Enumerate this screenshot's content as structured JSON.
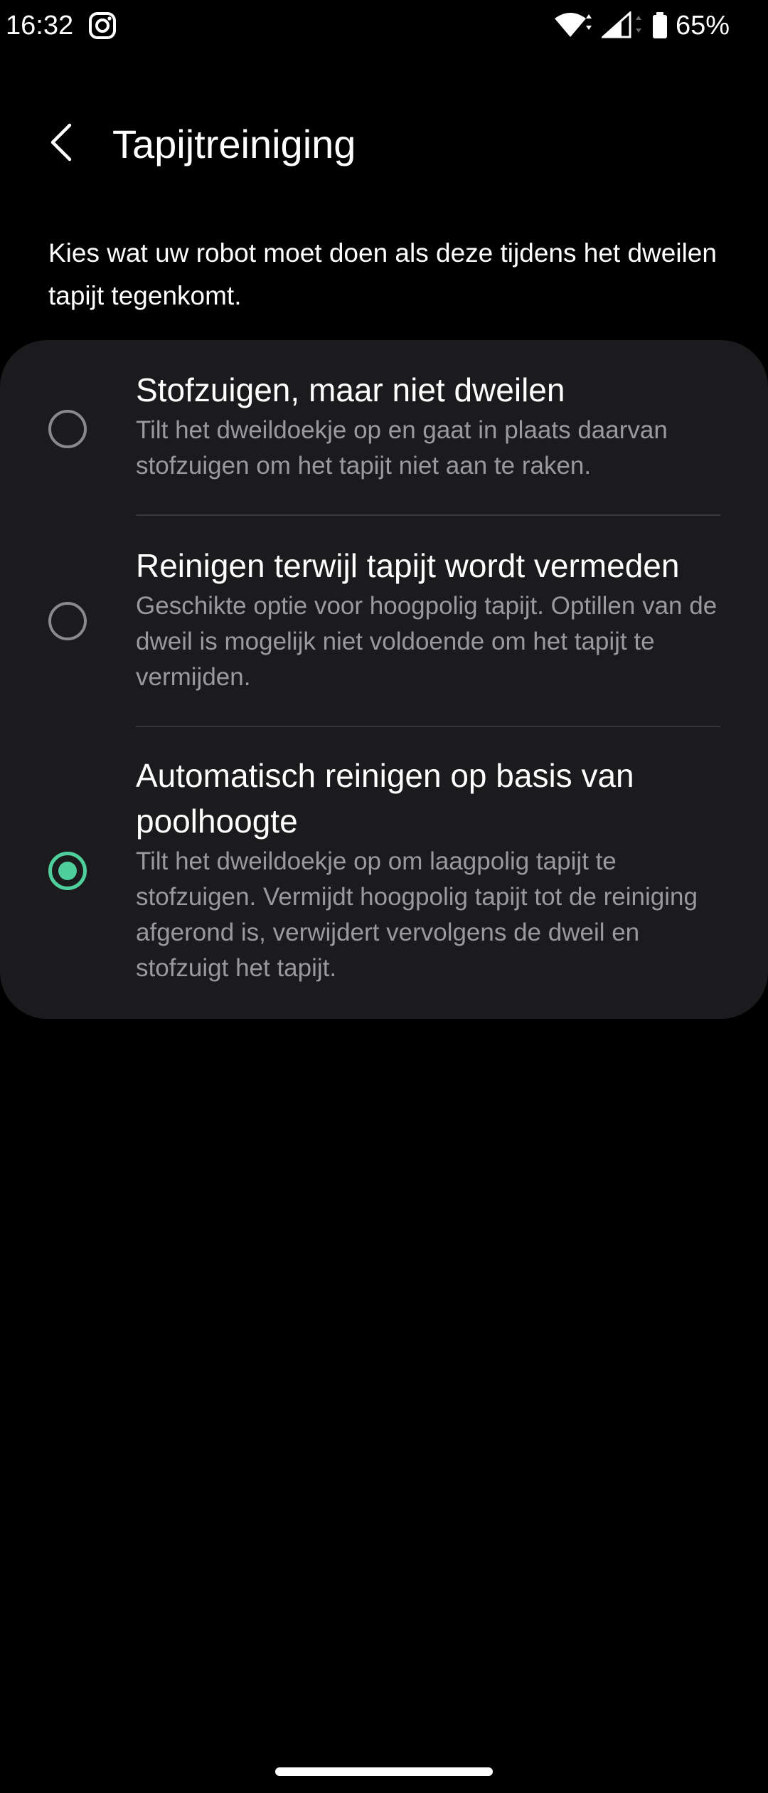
{
  "status_bar": {
    "time": "16:32",
    "notification_icon": "instagram-icon",
    "battery_text": "65%"
  },
  "header": {
    "back_icon": "chevron-left-icon",
    "title": "Tapijtreiniging"
  },
  "description": "Kies wat uw robot moet doen als deze tijdens het dweilen tapijt tegenkomt.",
  "options": [
    {
      "title": "Stofzuigen, maar niet dweilen",
      "description": "Tilt het dweildoekje op en gaat in plaats daarvan stofzuigen om het tapijt niet aan te raken.",
      "selected": false
    },
    {
      "title": "Reinigen terwijl tapijt wordt vermeden",
      "description": "Geschikte optie voor hoogpolig tapijt. Optillen van de dweil is mogelijk niet voldoende om het tapijt te vermijden.",
      "selected": false
    },
    {
      "title": "Automatisch reinigen op basis van poolhoogte",
      "description": "Tilt het dweildoekje op om laagpolig tapijt te stofzuigen. Vermijdt hoogpolig tapijt tot de reiniging afgerond is, verwijdert vervolgens de dweil en stofzuigt het tapijt.",
      "selected": true
    }
  ],
  "colors": {
    "background": "#000000",
    "card": "#1b1b1d",
    "accent": "#4fcf9b",
    "secondary_text": "#9a9a9c"
  }
}
